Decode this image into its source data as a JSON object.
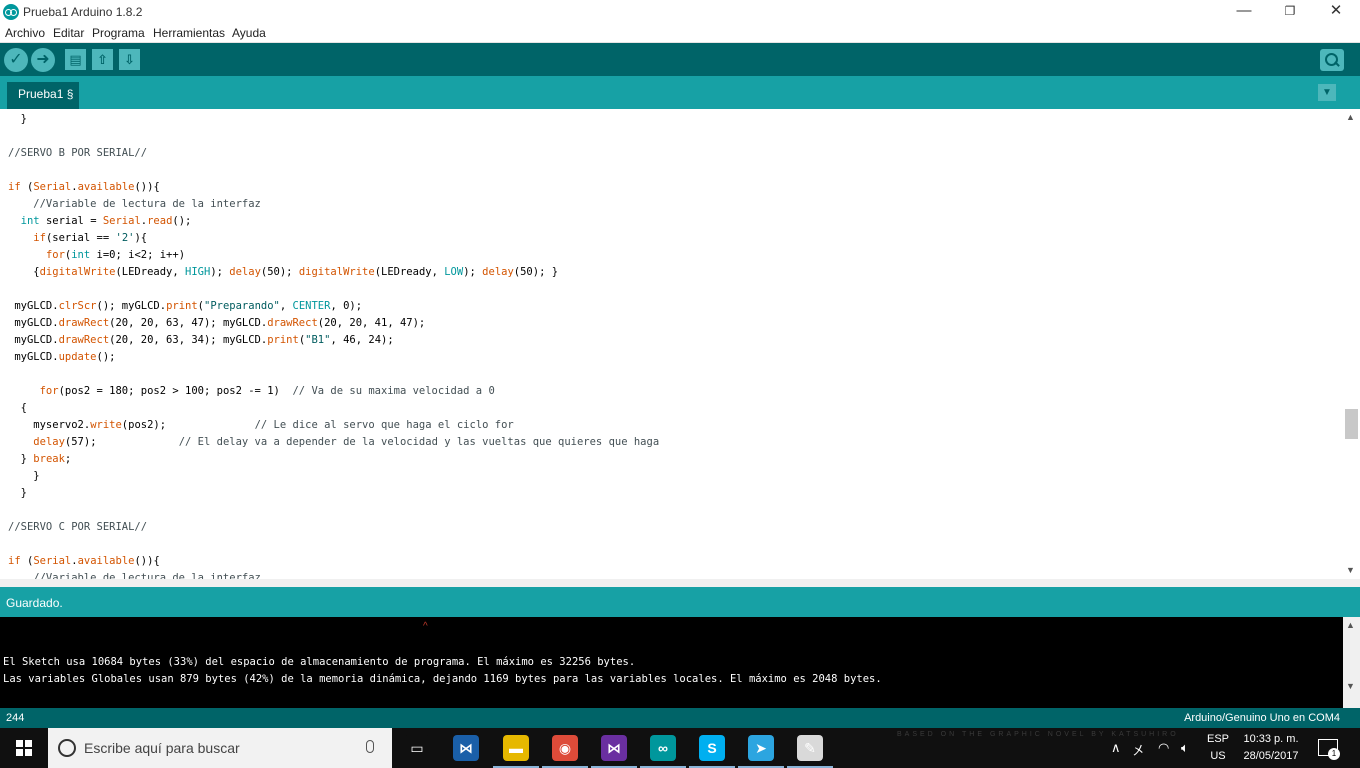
{
  "window": {
    "title": "Prueba1 Arduino 1.8.2",
    "min_glyph": "—",
    "max_glyph": "❐",
    "close_glyph": "✕"
  },
  "menu": [
    "Archivo",
    "Editar",
    "Programa",
    "Herramientas",
    "Ayuda"
  ],
  "toolbar": {
    "verify_icon": "check-icon",
    "upload_icon": "arrow-right-icon",
    "new_icon": "document-icon",
    "open_icon": "arrow-up-icon",
    "save_icon": "arrow-down-icon",
    "serial_monitor_icon": "magnifier-icon"
  },
  "tabs": [
    {
      "label": "Prueba1 §",
      "active": true
    }
  ],
  "editor": {
    "lines": [
      [
        [
          "  }",
          "p"
        ]
      ],
      [
        [
          "",
          "p"
        ]
      ],
      [
        [
          "//SERVO B POR SERIAL//",
          "c"
        ]
      ],
      [
        [
          "",
          "p"
        ]
      ],
      [
        [
          "if",
          "k"
        ],
        [
          " (",
          "p"
        ],
        [
          "Serial",
          "f"
        ],
        [
          ".",
          "p"
        ],
        [
          "available",
          "f"
        ],
        [
          "()){",
          "p"
        ]
      ],
      [
        [
          "    //Variable de lectura de la interfaz",
          "c"
        ]
      ],
      [
        [
          "  ",
          "p"
        ],
        [
          "int",
          "t"
        ],
        [
          " serial = ",
          "p"
        ],
        [
          "Serial",
          "f"
        ],
        [
          ".",
          "p"
        ],
        [
          "read",
          "f"
        ],
        [
          "();",
          "p"
        ]
      ],
      [
        [
          "    ",
          "p"
        ],
        [
          "if",
          "k"
        ],
        [
          "(serial == ",
          "p"
        ],
        [
          "'2'",
          "s"
        ],
        [
          "){",
          "p"
        ]
      ],
      [
        [
          "      ",
          "p"
        ],
        [
          "for",
          "k"
        ],
        [
          "(",
          "p"
        ],
        [
          "int",
          "t"
        ],
        [
          " i=0; i<2; i++)",
          "p"
        ]
      ],
      [
        [
          "    {",
          "p"
        ],
        [
          "digitalWrite",
          "f"
        ],
        [
          "(LEDready, ",
          "p"
        ],
        [
          "HIGH",
          "t"
        ],
        [
          "); ",
          "p"
        ],
        [
          "delay",
          "f"
        ],
        [
          "(50); ",
          "p"
        ],
        [
          "digitalWrite",
          "f"
        ],
        [
          "(LEDready, ",
          "p"
        ],
        [
          "LOW",
          "t"
        ],
        [
          "); ",
          "p"
        ],
        [
          "delay",
          "f"
        ],
        [
          "(50); }",
          "p"
        ]
      ],
      [
        [
          "",
          "p"
        ]
      ],
      [
        [
          " myGLCD.",
          "p"
        ],
        [
          "clrScr",
          "f"
        ],
        [
          "(); myGLCD.",
          "p"
        ],
        [
          "print",
          "f"
        ],
        [
          "(",
          "p"
        ],
        [
          "\"Preparando\"",
          "s"
        ],
        [
          ", ",
          "p"
        ],
        [
          "CENTER",
          "t"
        ],
        [
          ", 0);",
          "p"
        ]
      ],
      [
        [
          " myGLCD.",
          "p"
        ],
        [
          "drawRect",
          "f"
        ],
        [
          "(20, 20, 63, 47); myGLCD.",
          "p"
        ],
        [
          "drawRect",
          "f"
        ],
        [
          "(20, 20, 41, 47);",
          "p"
        ]
      ],
      [
        [
          " myGLCD.",
          "p"
        ],
        [
          "drawRect",
          "f"
        ],
        [
          "(20, 20, 63, 34); myGLCD.",
          "p"
        ],
        [
          "print",
          "f"
        ],
        [
          "(",
          "p"
        ],
        [
          "\"B1\"",
          "s"
        ],
        [
          ", 46, 24);",
          "p"
        ]
      ],
      [
        [
          " myGLCD.",
          "p"
        ],
        [
          "update",
          "f"
        ],
        [
          "();",
          "p"
        ]
      ],
      [
        [
          "",
          "p"
        ]
      ],
      [
        [
          "     ",
          "p"
        ],
        [
          "for",
          "k"
        ],
        [
          "(pos2 = 180; pos2 > 100; pos2 -= 1)  ",
          "p"
        ],
        [
          "// Va de su maxima velocidad a 0",
          "c"
        ]
      ],
      [
        [
          "  {",
          "p"
        ]
      ],
      [
        [
          "    myservo2.",
          "p"
        ],
        [
          "write",
          "f"
        ],
        [
          "(pos2);              ",
          "p"
        ],
        [
          "// Le dice al servo que haga el ciclo for",
          "c"
        ]
      ],
      [
        [
          "    ",
          "p"
        ],
        [
          "delay",
          "f"
        ],
        [
          "(57);             ",
          "p"
        ],
        [
          "// El delay va a depender de la velocidad y las vueltas que quieres que haga",
          "c"
        ]
      ],
      [
        [
          "  } ",
          "p"
        ],
        [
          "break",
          "k"
        ],
        [
          ";",
          "p"
        ]
      ],
      [
        [
          "    }",
          "p"
        ]
      ],
      [
        [
          "  }",
          "p"
        ]
      ],
      [
        [
          "",
          "p"
        ]
      ],
      [
        [
          "//SERVO C POR SERIAL//",
          "c"
        ]
      ],
      [
        [
          "",
          "p"
        ]
      ],
      [
        [
          "if",
          "k"
        ],
        [
          " (",
          "p"
        ],
        [
          "Serial",
          "f"
        ],
        [
          ".",
          "p"
        ],
        [
          "available",
          "f"
        ],
        [
          "()){",
          "p"
        ]
      ],
      [
        [
          "    //Variable de lectura de la interfaz",
          "c"
        ]
      ]
    ]
  },
  "status": {
    "message": "Guardado."
  },
  "console": {
    "lines": [
      "El Sketch usa 10684 bytes (33%) del espacio de almacenamiento de programa. El máximo es 32256 bytes.",
      "Las variables Globales usan 879 bytes (42%) de la memoria dinámica, dejando 1169 bytes para las variables locales. El máximo es 2048 bytes."
    ]
  },
  "footer": {
    "line_number": "244",
    "board": "Arduino/Genuino Uno en COM4"
  },
  "taskbar": {
    "search_placeholder": "Escribe aquí para buscar",
    "apps": [
      {
        "name": "task-view",
        "glyph": "▭",
        "color": "#101010"
      },
      {
        "name": "visual-studio-code",
        "glyph": "⋈",
        "color": "#1a5fa8"
      },
      {
        "name": "file-explorer",
        "glyph": "▬",
        "color": "#e6b800"
      },
      {
        "name": "chrome",
        "glyph": "◉",
        "color": "#dd4b39"
      },
      {
        "name": "visual-studio",
        "glyph": "⋈",
        "color": "#6a2fa0"
      },
      {
        "name": "arduino",
        "glyph": "∞",
        "color": "#00979c"
      },
      {
        "name": "skype",
        "glyph": "S",
        "color": "#00aff0"
      },
      {
        "name": "telegram",
        "glyph": "➤",
        "color": "#2ca5e0"
      },
      {
        "name": "paint",
        "glyph": "✎",
        "color": "#d9d9d9"
      }
    ],
    "lang_top": "ESP",
    "lang_bottom": "US",
    "time": "10:33 p. m.",
    "date": "28/05/2017",
    "notifications": "1",
    "wallpaper_text": "BASED ON THE GRAPHIC NOVEL BY KATSUHIRO"
  },
  "colors": {
    "toolbar": "#006468",
    "tabbar": "#17a1a5",
    "keyword": "#d35400",
    "type": "#00979c",
    "comment": "#434f54"
  }
}
